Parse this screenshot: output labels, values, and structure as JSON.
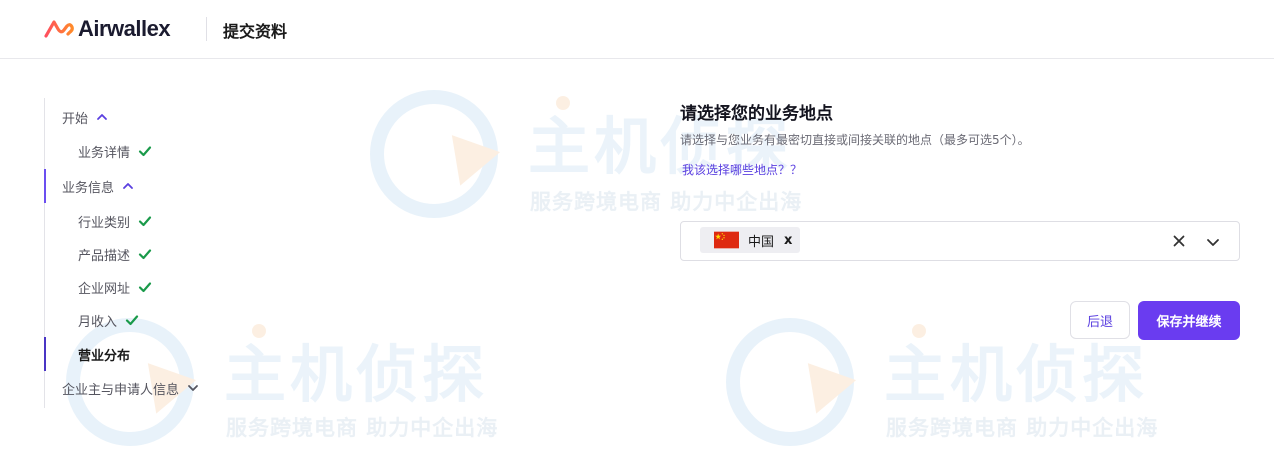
{
  "header": {
    "brand": "Airwallex",
    "title": "提交资料"
  },
  "watermark": {
    "main_text": "主机侦探",
    "sub_text": "服务跨境电商  助力中企出海"
  },
  "stepper": {
    "items": [
      {
        "label": "开始",
        "type": "section",
        "state": "expanded"
      },
      {
        "label": "业务详情",
        "type": "sub",
        "state": "done"
      },
      {
        "label": "业务信息",
        "type": "section",
        "state": "expanded"
      },
      {
        "label": "行业类别",
        "type": "sub",
        "state": "done"
      },
      {
        "label": "产品描述",
        "type": "sub",
        "state": "done"
      },
      {
        "label": "企业网址",
        "type": "sub",
        "state": "done"
      },
      {
        "label": "月收入",
        "type": "sub",
        "state": "done"
      },
      {
        "label": "营业分布",
        "type": "sub",
        "state": "current"
      },
      {
        "label": "企业主与申请人信息",
        "type": "section",
        "state": "collapsed"
      }
    ]
  },
  "form": {
    "title": "请选择您的业务地点",
    "description": "请选择与您业务有最密切直接或间接关联的地点（最多可选5个）。",
    "help_link": "我该选择哪些地点？？",
    "selected": [
      {
        "label": "中国",
        "flag": "china-flag",
        "remove": "x"
      }
    ],
    "back_label": "后退",
    "save_label": "保存并继续"
  },
  "colors": {
    "accent": "#6a3cf0",
    "link": "#5a3fe0",
    "check": "#1a9a4a",
    "brand_orange": "#ff5a3c"
  }
}
